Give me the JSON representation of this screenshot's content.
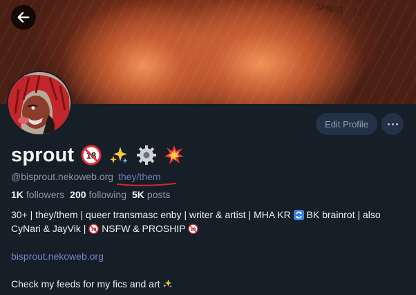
{
  "banner": {
    "signature": "SPROUT '25"
  },
  "actions": {
    "edit_profile": "Edit Profile"
  },
  "profile": {
    "display_name": "sprout",
    "name_emojis": [
      "adults-only-icon",
      "sparkles-icon",
      "gear-icon",
      "collision-icon"
    ],
    "handle": "@bisprout.nekoweb.org",
    "pronouns": "they/them"
  },
  "stats": {
    "followers_count": "1K",
    "followers_label": "followers",
    "following_count": "200",
    "following_label": "following",
    "posts_count": "5K",
    "posts_label": "posts"
  },
  "bio": {
    "line1_a": "30+ | they/them | queer transmasc enby | writer & artist | MHA KR",
    "line1_b": "BK brainrot | also",
    "line2_a": "CyNari & JayVik |",
    "line2_b": "NSFW & PROSHIP",
    "link": "bisprout.nekoweb.org",
    "line4": "Check my feeds for my fics and art"
  },
  "colors": {
    "background": "#161e27",
    "link": "#6f86c8",
    "muted": "#8b97a8",
    "button_bg": "#243147"
  }
}
